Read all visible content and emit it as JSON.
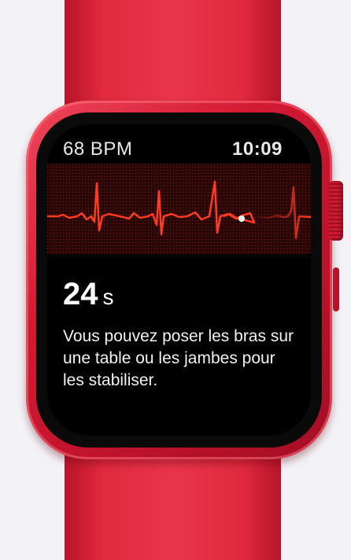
{
  "status": {
    "heart_rate": "68 BPM",
    "time": "10:09"
  },
  "recording": {
    "seconds_value": "24",
    "seconds_unit": "s"
  },
  "message": "Vous pouvez poser les bras sur une table ou les jambes pour les stabiliser.",
  "colors": {
    "watch_red": "#d21a33",
    "ecg_trace": "#ff3b20",
    "grid_red": "#7a0f12",
    "screen_bg": "#000000"
  },
  "icons": {
    "progress_dot": "white-dot"
  }
}
